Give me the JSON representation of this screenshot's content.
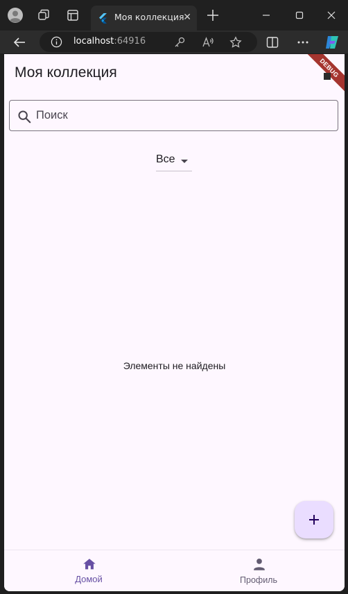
{
  "browser": {
    "tab_title": "Моя коллекция",
    "tab_close": "✕",
    "url_host": "localhost",
    "url_port": ":64916"
  },
  "app": {
    "title": "Моя коллекция",
    "debug_banner": "DEBUG",
    "search_placeholder": "Поиск",
    "search_value": "",
    "filter_selected": "Все",
    "empty_message": "Элементы не найдены",
    "fab_icon": "plus-icon",
    "accent_color": "#6750a4",
    "background_color": "#fef7ff"
  },
  "bottom_nav": {
    "items": [
      {
        "label": "Домой",
        "icon": "home-icon",
        "active": true
      },
      {
        "label": "Профиль",
        "icon": "person-icon",
        "active": false
      }
    ]
  }
}
